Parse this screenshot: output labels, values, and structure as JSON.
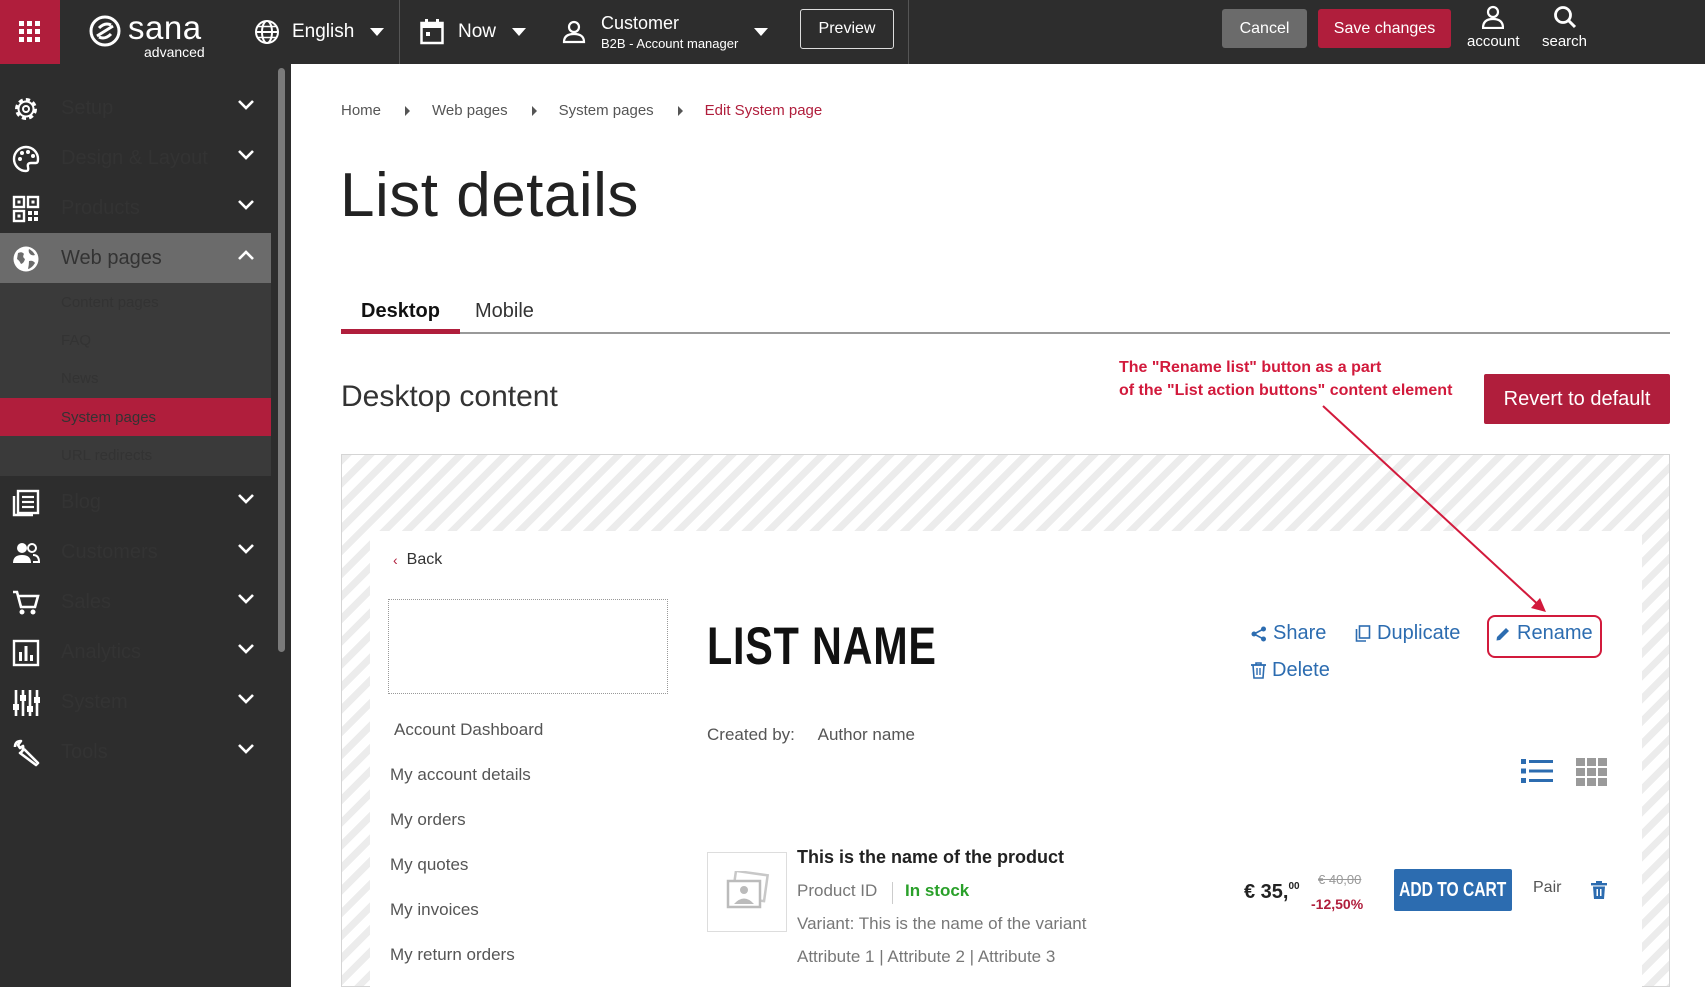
{
  "topbar": {
    "brand": "sana",
    "brand_sub": "advanced",
    "language": "English",
    "date": "Now",
    "customer_label": "Customer",
    "customer_sub": "B2B - Account manager",
    "preview": "Preview",
    "cancel": "Cancel",
    "save": "Save changes",
    "account": "account",
    "search": "search"
  },
  "sidebar": {
    "items": [
      {
        "label": "Setup",
        "icon": "gear-icon"
      },
      {
        "label": "Design & Layout",
        "icon": "palette-icon"
      },
      {
        "label": "Products",
        "icon": "qr-grid-icon"
      },
      {
        "label": "Web pages",
        "icon": "globe-icon"
      },
      {
        "label": "Blog",
        "icon": "blog-icon"
      },
      {
        "label": "Customers",
        "icon": "people-icon"
      },
      {
        "label": "Sales",
        "icon": "cart-icon"
      },
      {
        "label": "Analytics",
        "icon": "chart-icon"
      },
      {
        "label": "System",
        "icon": "sliders-icon"
      },
      {
        "label": "Tools",
        "icon": "wrench-icon"
      }
    ],
    "sub_items": [
      {
        "label": "Content pages"
      },
      {
        "label": "FAQ"
      },
      {
        "label": "News"
      },
      {
        "label": "System pages"
      },
      {
        "label": "URL redirects"
      }
    ]
  },
  "breadcrumb": [
    "Home",
    "Web pages",
    "System pages",
    "Edit System page"
  ],
  "page_title": "List details",
  "tabs": [
    "Desktop",
    "Mobile"
  ],
  "section_title": "Desktop content",
  "revert_button": "Revert to default",
  "annotation": {
    "line1": "The \"Rename list\" button as a part",
    "line2": "of the \"List action buttons\" content element"
  },
  "preview": {
    "back": "Back",
    "list_name": "LIST NAME",
    "actions": {
      "share": "Share",
      "duplicate": "Duplicate",
      "rename": "Rename",
      "delete": "Delete"
    },
    "account_menu": [
      "Account Dashboard",
      "My account details",
      "My orders",
      "My quotes",
      "My invoices",
      "My return orders"
    ],
    "created_by_label": "Created by:",
    "created_by_value": "Author name",
    "product": {
      "name": "This is the name of the product",
      "id_label": "Product ID",
      "stock": "In stock",
      "variant": "Variant: This is the name of the variant",
      "attributes": "Attribute 1  |  Attribute 2  |  Attribute 3",
      "price_main": "€ 35,",
      "price_cents": "00",
      "old_price": "€ 40,00",
      "discount": "-12,50%",
      "add_to_cart": "ADD TO CART",
      "uom": "Pair"
    }
  },
  "colors": {
    "brand_red": "#b01e3c",
    "sidebar_bg": "#2d2d2d",
    "link_blue": "#2c6cb0",
    "stock_green": "#2aa02a",
    "annotation_red": "#d21a3c"
  }
}
